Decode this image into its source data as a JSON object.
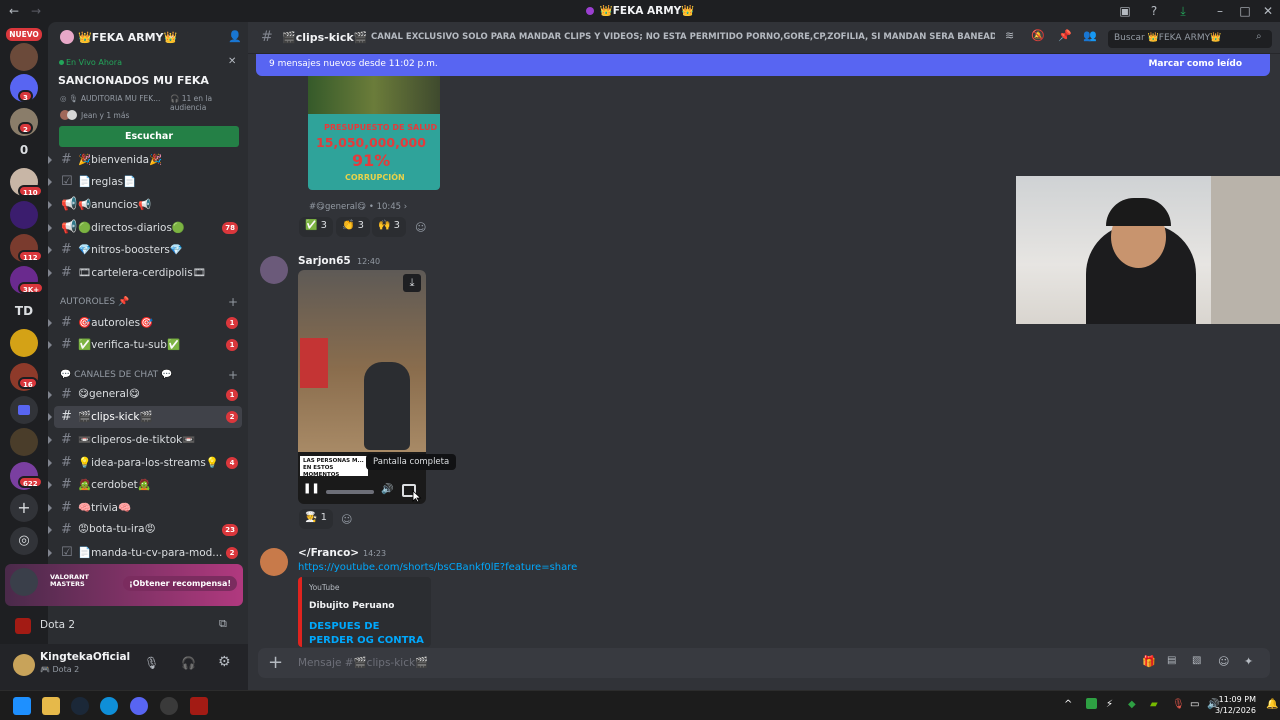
{
  "window": {
    "title": "👑FEKA ARMY👑"
  },
  "rail": {
    "nuevo_label": "NUEVO",
    "servers": [
      {
        "name": "server-1",
        "badge": ""
      },
      {
        "name": "server-2",
        "badge": "3"
      },
      {
        "name": "server-3",
        "badge": "2"
      },
      {
        "name": "server-4",
        "label": "0"
      },
      {
        "name": "server-5",
        "badge": "110"
      },
      {
        "name": "server-6",
        "badge": ""
      },
      {
        "name": "server-7",
        "badge": "112"
      },
      {
        "name": "server-8",
        "badge": "3K+"
      },
      {
        "name": "server-9",
        "label": "TD"
      },
      {
        "name": "server-10",
        "badge": ""
      },
      {
        "name": "server-11",
        "badge": "16"
      },
      {
        "name": "server-12",
        "badge": ""
      },
      {
        "name": "server-13",
        "badge": ""
      },
      {
        "name": "server-14",
        "badge": "622"
      }
    ]
  },
  "sidebar": {
    "server_name": "👑FEKA ARMY👑",
    "live": {
      "status": "En Vivo Ahora",
      "title": "SANCIONADOS MU FEKA",
      "channel": "AUDITORIA MU FEK...",
      "audience": "11 en la audiencia",
      "participants": "Jean y 1 más",
      "listen_button": "Escuchar"
    },
    "channels": [
      {
        "name": "🎉bienvenida🎉",
        "icon": "hash",
        "badge": ""
      },
      {
        "name": "📄reglas📄",
        "icon": "rules",
        "badge": ""
      },
      {
        "name": "📢anuncios📢",
        "icon": "megaphone",
        "badge": ""
      },
      {
        "name": "🟢directos-diarios🟢",
        "icon": "megaphone",
        "badge": "78"
      },
      {
        "name": "💎nitros-boosters💎",
        "icon": "hash",
        "badge": ""
      },
      {
        "name": "🎞cartelera-cerdipolis🎞",
        "icon": "hash",
        "badge": ""
      }
    ],
    "cat_autoroles": "AUTOROLES 📌",
    "channels_autoroles": [
      {
        "name": "🎯autoroles🎯",
        "badge": "1"
      },
      {
        "name": "✅verifica-tu-sub✅",
        "badge": "1"
      }
    ],
    "cat_chat": "💬 CANALES DE CHAT 💬",
    "channels_chat": [
      {
        "name": "😋general😋",
        "badge": "1"
      },
      {
        "name": "🎬clips-kick🎬",
        "badge": "2",
        "active": true
      },
      {
        "name": "📼cliperos-de-tiktok📼",
        "badge": ""
      },
      {
        "name": "💡idea-para-los-streams💡",
        "badge": "4"
      },
      {
        "name": "🧟cerdobet🧟",
        "badge": ""
      },
      {
        "name": "🧠trivia🧠",
        "badge": ""
      },
      {
        "name": "😡bota-tu-ira😡",
        "badge": "23"
      },
      {
        "name": "📄manda-tu-cv-para-mod...",
        "badge": "2"
      }
    ],
    "promo": {
      "game_label": "VALORANT MASTERS",
      "button": "¡Obtener recompensa!"
    },
    "playing": "Dota 2",
    "user": {
      "name": "KingtekaOficial",
      "status": "Dota 2"
    }
  },
  "main": {
    "channel_name": "🎬clips-kick🎬",
    "topic": "CANAL EXCLUSIVO SOLO PARA MANDAR CLIPS Y VIDEOS; NO ESTA PERMITIDO PORNO,GORE,CP,ZOFILIA, SI MANDAN SERA BANEADO PERMA...",
    "search_placeholder": "Buscar 👑FEKA ARMY👑",
    "new_messages": "9 mensajes nuevos desde 11:02 p.m.",
    "mark_read": "Marcar como leído",
    "msg1": {
      "image_headline": "PRESUPUESTO DE SALUD",
      "image_number": "15,050,000,000",
      "image_percent": "91%",
      "image_word": "CORRUPCIÓN",
      "forward_channel": "#😋general😋",
      "forward_time": "10:45",
      "reactions": [
        {
          "emoji": "✅",
          "count": "3"
        },
        {
          "emoji": "👏",
          "count": "3"
        },
        {
          "emoji": "🙌",
          "count": "3"
        }
      ]
    },
    "msg2": {
      "author": "Sarjon65",
      "time": "12:40",
      "video_caption": "LAS PERSONAS M... EN ESTOS MOMENTOS",
      "tooltip": "Pantalla completa",
      "reaction_count": "1"
    },
    "msg3": {
      "author": "</Franco>",
      "time": "14:23",
      "link": "https://youtube.com/shorts/bsCBankf0lE?feature=share",
      "embed_provider": "YouTube",
      "embed_author": "Dibujito Peruano",
      "embed_title": "DESPUES DE PERDER OG CONTRA PARKER |"
    },
    "composer_placeholder": "Mensaje #🎬clips-kick🎬"
  },
  "taskbar": {
    "time": "11:09 PM",
    "date": "3/12/2026"
  }
}
